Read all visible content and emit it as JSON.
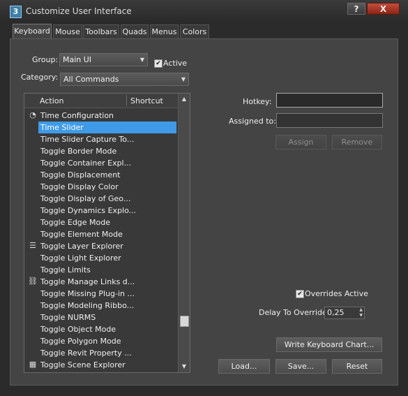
{
  "window": {
    "title": "Customize User Interface",
    "app_icon": "3",
    "help_label": "?",
    "close_label": "X"
  },
  "tabs": [
    "Keyboard",
    "Mouse",
    "Toolbars",
    "Quads",
    "Menus",
    "Colors"
  ],
  "active_tab": "Keyboard",
  "group": {
    "label": "Group:",
    "value": "Main UI"
  },
  "active_checkbox": {
    "label": "Active",
    "checked": true
  },
  "category": {
    "label": "Category:",
    "value": "All Commands"
  },
  "list": {
    "columns": [
      "Action",
      "Shortcut"
    ],
    "items": [
      {
        "label": "Time Configuration",
        "icon": "clock-gear-icon"
      },
      {
        "label": "Time Slider",
        "selected": true
      },
      {
        "label": "Time Slider Capture To..."
      },
      {
        "label": "Toggle Border Mode"
      },
      {
        "label": "Toggle Container Expl..."
      },
      {
        "label": "Toggle Displacement"
      },
      {
        "label": "Toggle Display Color"
      },
      {
        "label": "Toggle Display of Geo..."
      },
      {
        "label": "Toggle Dynamics Explo..."
      },
      {
        "label": "Toggle Edge Mode"
      },
      {
        "label": "Toggle Element Mode"
      },
      {
        "label": "Toggle Layer Explorer",
        "icon": "layer-explorer-icon"
      },
      {
        "label": "Toggle Light Explorer"
      },
      {
        "label": "Toggle Limits"
      },
      {
        "label": "Toggle Manage Links d...",
        "icon": "manage-links-icon"
      },
      {
        "label": "Toggle Missing Plug-in ..."
      },
      {
        "label": "Toggle Modeling Ribbo..."
      },
      {
        "label": "Toggle NURMS"
      },
      {
        "label": "Toggle Object Mode"
      },
      {
        "label": "Toggle Polygon Mode"
      },
      {
        "label": "Toggle Revit Property ..."
      },
      {
        "label": "Toggle Scene Explorer",
        "icon": "scene-explorer-icon"
      }
    ]
  },
  "hotkey": {
    "label": "Hotkey:",
    "value": ""
  },
  "assigned_to": {
    "label": "Assigned to:",
    "value": ""
  },
  "buttons": {
    "assign": "Assign",
    "remove": "Remove",
    "write_chart": "Write Keyboard Chart...",
    "load": "Load...",
    "save": "Save...",
    "reset": "Reset"
  },
  "overrides": {
    "label": "Overrides Active",
    "checked": true
  },
  "delay": {
    "label": "Delay To Override:",
    "value": "0,25"
  }
}
